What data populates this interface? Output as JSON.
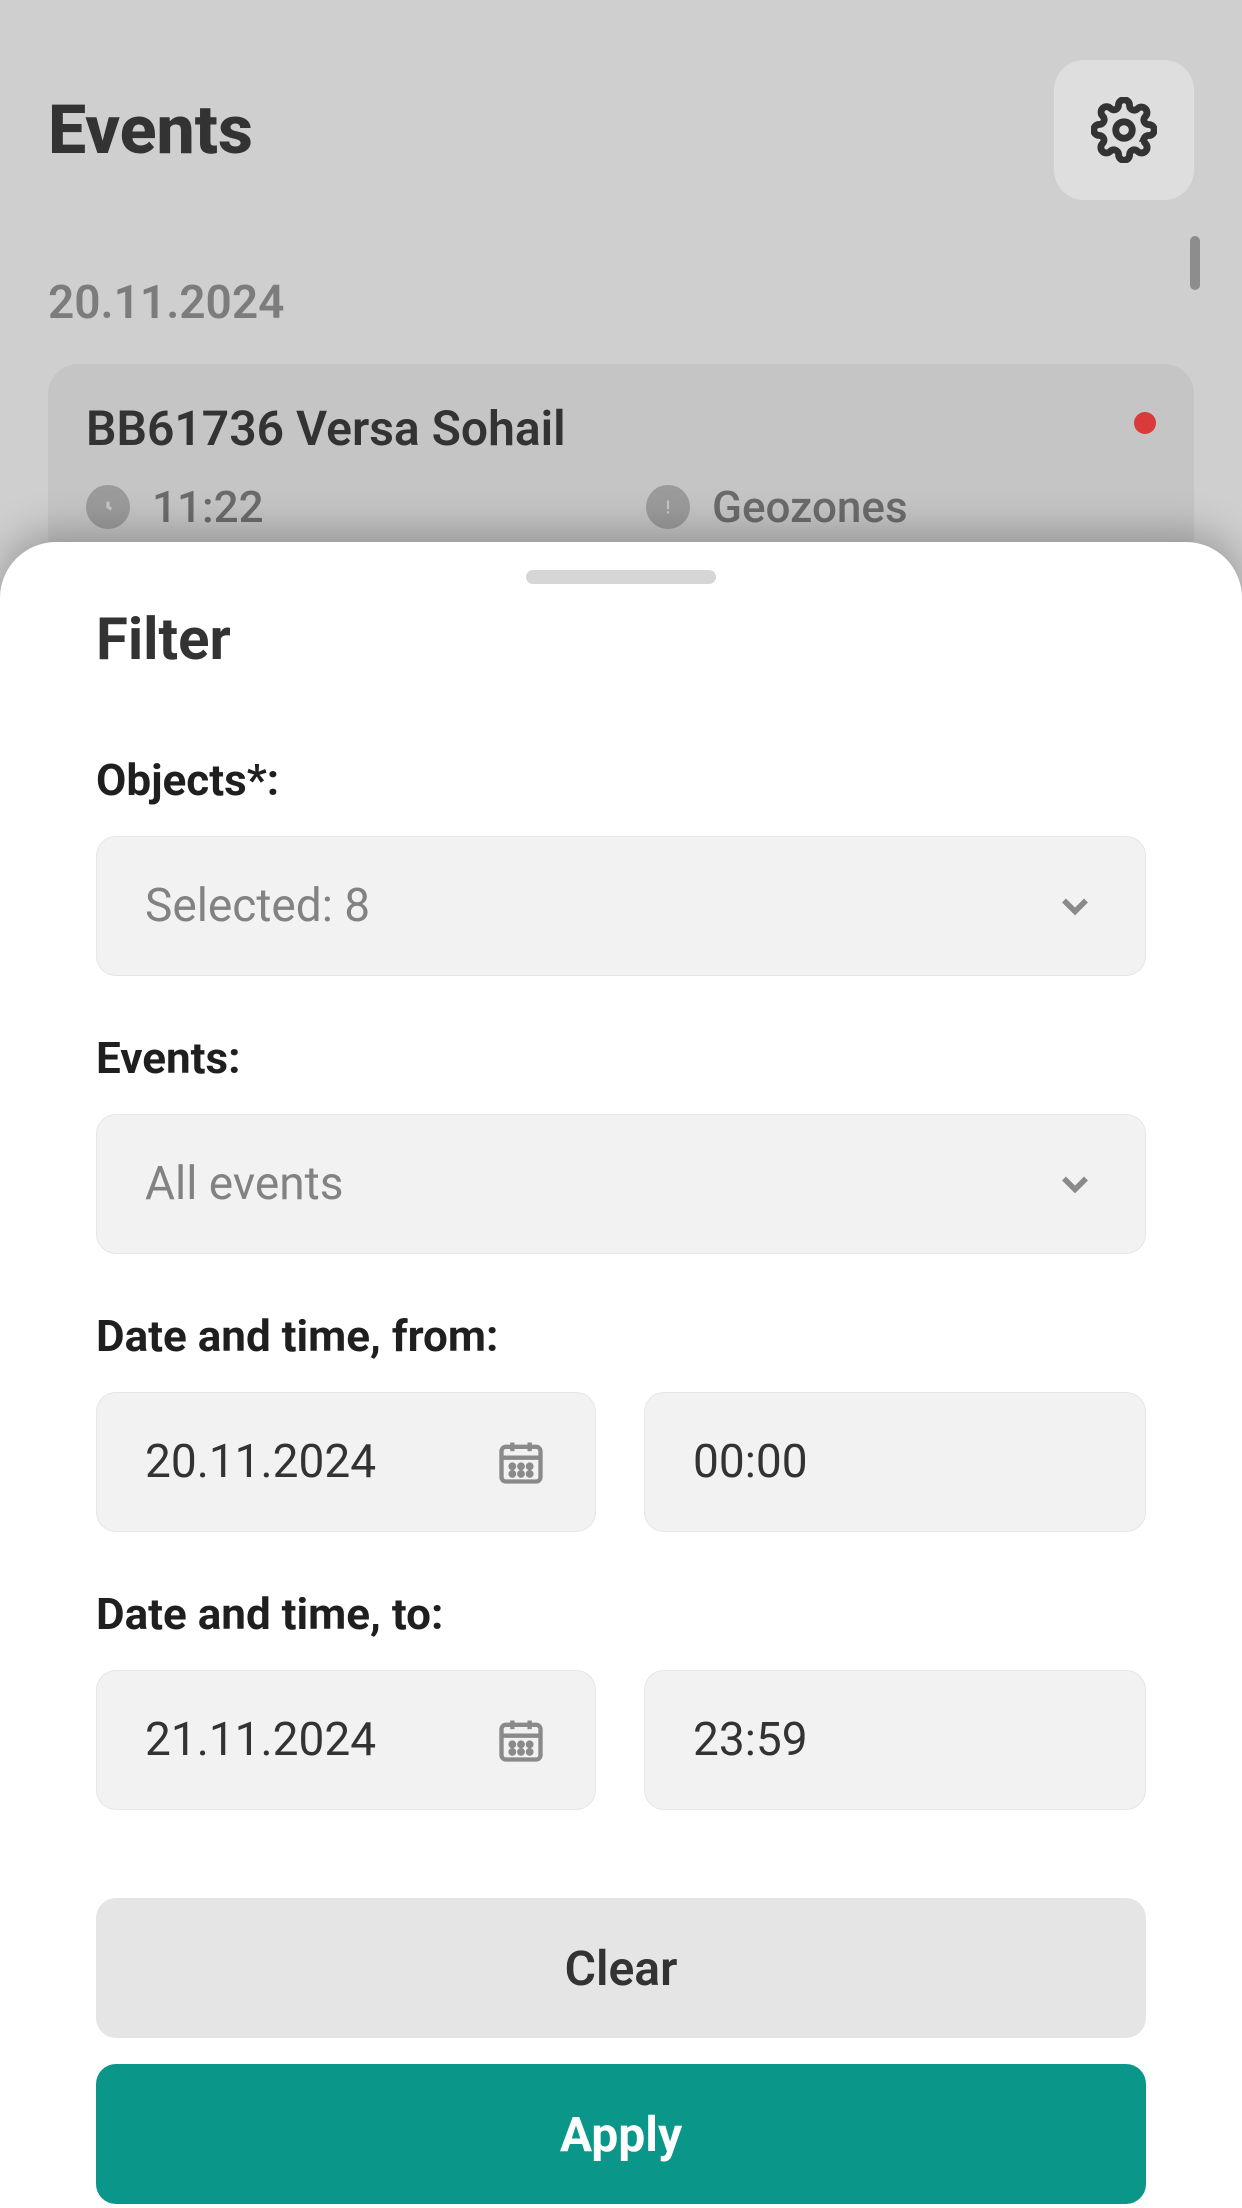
{
  "header": {
    "title": "Events"
  },
  "bg": {
    "date_label": "20.11.2024",
    "card": {
      "title": "BB61736 Versa Sohail",
      "time": "11:22",
      "category": "Geozones"
    }
  },
  "filter": {
    "title": "Filter",
    "objects_label": "Objects*:",
    "objects_value": "Selected: 8",
    "events_label": "Events:",
    "events_value": "All events",
    "from_label": "Date and time, from:",
    "from_date": "20.11.2024",
    "from_time": "00:00",
    "to_label": "Date and time, to:",
    "to_date": "21.11.2024",
    "to_time": "23:59",
    "clear_label": "Clear",
    "apply_label": "Apply"
  }
}
